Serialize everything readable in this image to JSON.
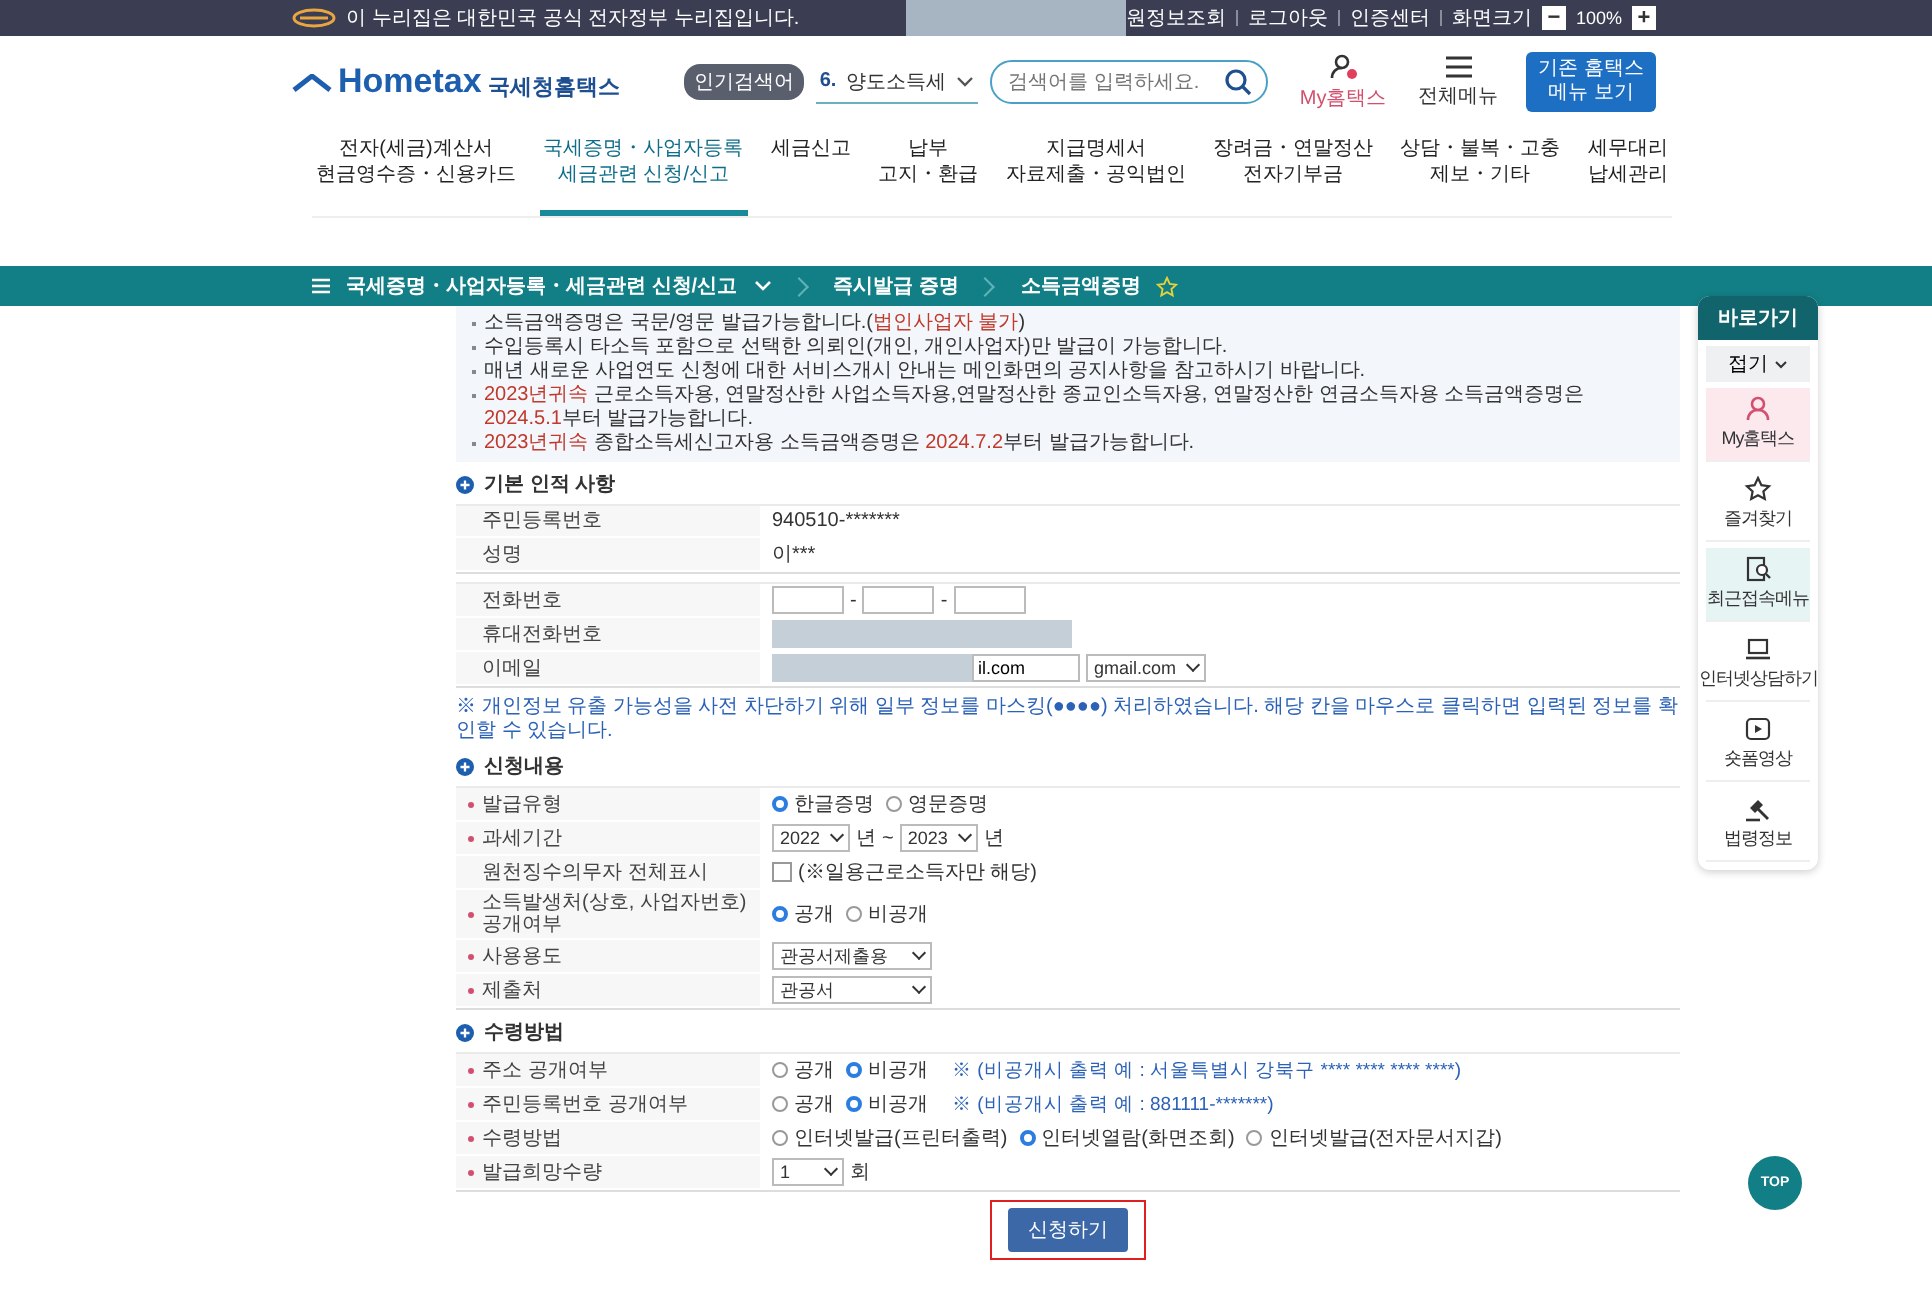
{
  "top_bar": {
    "notice": "이 누리집은 대한민국 공식 전자정부 누리집입니다.",
    "links": [
      "원정보조회",
      "로그아웃",
      "인증센터",
      "화면크기"
    ],
    "zoom": {
      "minus": "−",
      "value": "100%",
      "plus": "+"
    }
  },
  "header": {
    "brand": "Hometax",
    "site_name": "국세청홈택스",
    "popular": {
      "badge": "인기검색어",
      "rank": "6.",
      "term": "양도소득세"
    },
    "search": {
      "placeholder": "검색어를 입력하세요."
    },
    "my_label": "My홈택스",
    "menu_label": "전체메뉴",
    "legacy_button": "기존 홈택스\n메뉴 보기"
  },
  "nav": [
    {
      "label": "전자(세금)계산서\n현금영수증・신용카드",
      "selected": false
    },
    {
      "label": "국세증명・사업자등록\n세금관련 신청/신고",
      "selected": true
    },
    {
      "label": "세금신고",
      "selected": false
    },
    {
      "label": "납부\n고지・환급",
      "selected": false
    },
    {
      "label": "지급명세서\n자료제출・공익법인",
      "selected": false
    },
    {
      "label": "장려금・연말정산\n전자기부금",
      "selected": false
    },
    {
      "label": "상담・불복・고충\n제보・기타",
      "selected": false
    },
    {
      "label": "세무대리\n납세관리",
      "selected": false
    }
  ],
  "breadcrumb": {
    "items": [
      "국세증명・사업자등록・세금관련 신청/신고",
      "즉시발급 증명",
      "소득금액증명"
    ],
    "favorite": false
  },
  "notices": [
    [
      {
        "text": "소득금액증명은 국문/영문 발급가능합니다.(",
        "highlight": false
      },
      {
        "text": "법인사업자 불가",
        "highlight": true
      },
      {
        "text": ")",
        "highlight": false
      }
    ],
    [
      {
        "text": "수입등록시 타소득 포함으로 선택한 의뢰인(개인, 개인사업자)만 발급이 가능합니다.",
        "highlight": false
      }
    ],
    [
      {
        "text": "매년 새로운 사업연도 신청에 대한 서비스개시 안내는 메인화면의 공지사항을 참고하시기 바랍니다.",
        "highlight": false
      }
    ],
    [
      {
        "text": "2023년귀속",
        "highlight": true
      },
      {
        "text": " 근로소득자용, 연말정산한 사업소득자용,연말정산한 종교인소득자용, 연말정산한 연금소득자용 소득금액증명은 ",
        "highlight": false
      },
      {
        "text": "2024.5.1",
        "highlight": true
      },
      {
        "text": "부터 발급가능합니다.",
        "highlight": false
      }
    ],
    [
      {
        "text": "2023년귀속",
        "highlight": true
      },
      {
        "text": " 종합소득세신고자용 소득금액증명은 ",
        "highlight": false
      },
      {
        "text": "2024.7.2",
        "highlight": true
      },
      {
        "text": "부터 발급가능합니다.",
        "highlight": false
      }
    ]
  ],
  "sections": [
    {
      "title": "기본 인적 사항",
      "tables": [
        [
          {
            "kind": "text",
            "label": "주민등록번호",
            "required": false,
            "value": "940510-*******"
          },
          {
            "kind": "text",
            "label": "성명",
            "required": false,
            "value": "이***"
          }
        ],
        [
          {
            "kind": "phone",
            "label": "전화번호",
            "required": false,
            "separators": [
              "-",
              "-"
            ]
          },
          {
            "kind": "masked",
            "label": "휴대전화번호",
            "required": false
          },
          {
            "kind": "email",
            "label": "이메일",
            "required": false,
            "value": "il.com",
            "domain": "gmail.com"
          }
        ]
      ],
      "note": "※ 개인정보 유출 가능성을 사전 차단하기 위해 일부 정보를 마스킹(●●●●) 처리하였습니다. 해당 칸을 마우스로 클릭하면 입력된 정보를 확인할 수 있습니다."
    },
    {
      "title": "신청내용",
      "tables": [
        [
          {
            "kind": "radio",
            "label": "발급유형",
            "required": true,
            "options": [
              {
                "label": "한글증명",
                "selected": true
              },
              {
                "label": "영문증명",
                "selected": false
              }
            ]
          },
          {
            "kind": "year_range",
            "label": "과세기간",
            "required": true,
            "from": "2022",
            "to": "2023",
            "units": [
              "년",
              "년"
            ],
            "separator": "~"
          },
          {
            "kind": "checkbox",
            "label": "원천징수의무자 전체표시",
            "required": false,
            "checked": false,
            "text": "(※일용근로소득자만 해당)"
          },
          {
            "kind": "radio",
            "label": "소득발생처(상호, 사업자번호)\n공개여부",
            "required": true,
            "options": [
              {
                "label": "공개",
                "selected": true
              },
              {
                "label": "비공개",
                "selected": false
              }
            ]
          },
          {
            "kind": "select",
            "label": "사용용도",
            "required": true,
            "value": "관공서제출용"
          },
          {
            "kind": "select",
            "label": "제출처",
            "required": true,
            "value": "관공서"
          }
        ]
      ]
    },
    {
      "title": "수령방법",
      "tables": [
        [
          {
            "kind": "radio",
            "label": "주소 공개여부",
            "required": true,
            "options": [
              {
                "label": "공개",
                "selected": false
              },
              {
                "label": "비공개",
                "selected": true
              }
            ],
            "note": "※ (비공개시 출력 예 : 서울특별시 강북구 **** **** **** ****)"
          },
          {
            "kind": "radio",
            "label": "주민등록번호 공개여부",
            "required": true,
            "options": [
              {
                "label": "공개",
                "selected": false
              },
              {
                "label": "비공개",
                "selected": true
              }
            ],
            "note": "※ (비공개시 출력 예 : 881111-*******)"
          },
          {
            "kind": "radio",
            "label": "수령방법",
            "required": true,
            "options": [
              {
                "label": "인터넷발급(프린터출력)",
                "selected": false
              },
              {
                "label": "인터넷열람(화면조회)",
                "selected": true
              },
              {
                "label": "인터넷발급(전자문서지갑)",
                "selected": false
              }
            ]
          },
          {
            "kind": "quantity",
            "label": "발급희망수량",
            "required": true,
            "value": "1",
            "unit": "회"
          }
        ]
      ]
    }
  ],
  "submit": {
    "label": "신청하기",
    "outlined": true
  },
  "sidebar": {
    "title": "바로가기",
    "collapse": "접기",
    "items": [
      {
        "label": "My홈택스",
        "color": "#fbe9ee"
      },
      {
        "label": "즐겨찾기"
      },
      {
        "label": "최근접속메뉴",
        "color": "#e6f4f3"
      },
      {
        "label": "인터넷상담하기"
      },
      {
        "label": "숏폼영상"
      },
      {
        "label": "법령정보"
      }
    ]
  },
  "top_button": "TOP"
}
